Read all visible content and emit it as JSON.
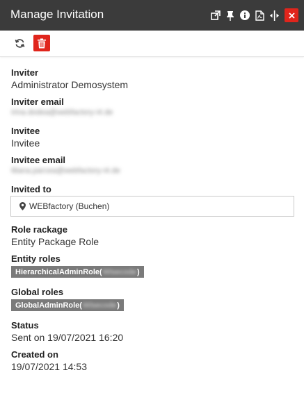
{
  "window": {
    "title": "Manage Invitation",
    "icons": [
      "popout-icon",
      "pin-icon",
      "info-icon",
      "pdf-icon",
      "resize-icon",
      "close-icon"
    ]
  },
  "toolbar": {
    "refresh_icon": "refresh-icon",
    "delete_icon": "trash-icon"
  },
  "fields": {
    "inviter": {
      "label": "Inviter",
      "value": "Administrator Demosystem"
    },
    "inviter_email": {
      "label": "Inviter email",
      "value": "irina.dodea@webfactory-i4.de"
    },
    "invitee": {
      "label": "Invitee",
      "value": "Invitee"
    },
    "invitee_email": {
      "label": "Invitee email",
      "value": "liliana.parcea@webfactory-i4.de"
    },
    "invited_to": {
      "label": "Invited to",
      "value": "WEBfactory (Buchen)"
    },
    "role_package": {
      "label": "Role rackage",
      "value": "Entity Package Role"
    },
    "entity_roles": {
      "label": "Entity roles",
      "chip_prefix": "HierarchicalAdminRole(",
      "chip_blurred": "Wisecode",
      "chip_suffix": ")"
    },
    "global_roles": {
      "label": "Global roles",
      "chip_prefix": "GlobalAdminRole(",
      "chip_blurred": "Wisecode",
      "chip_suffix": ")"
    },
    "status": {
      "label": "Status",
      "value": "Sent on 19/07/2021 16:20"
    },
    "created_on": {
      "label": "Created on",
      "value": "19/07/2021 14:53"
    }
  },
  "colors": {
    "titlebar": "#3b3b3b",
    "danger": "#e0251c",
    "chip": "#7a7a7a"
  }
}
